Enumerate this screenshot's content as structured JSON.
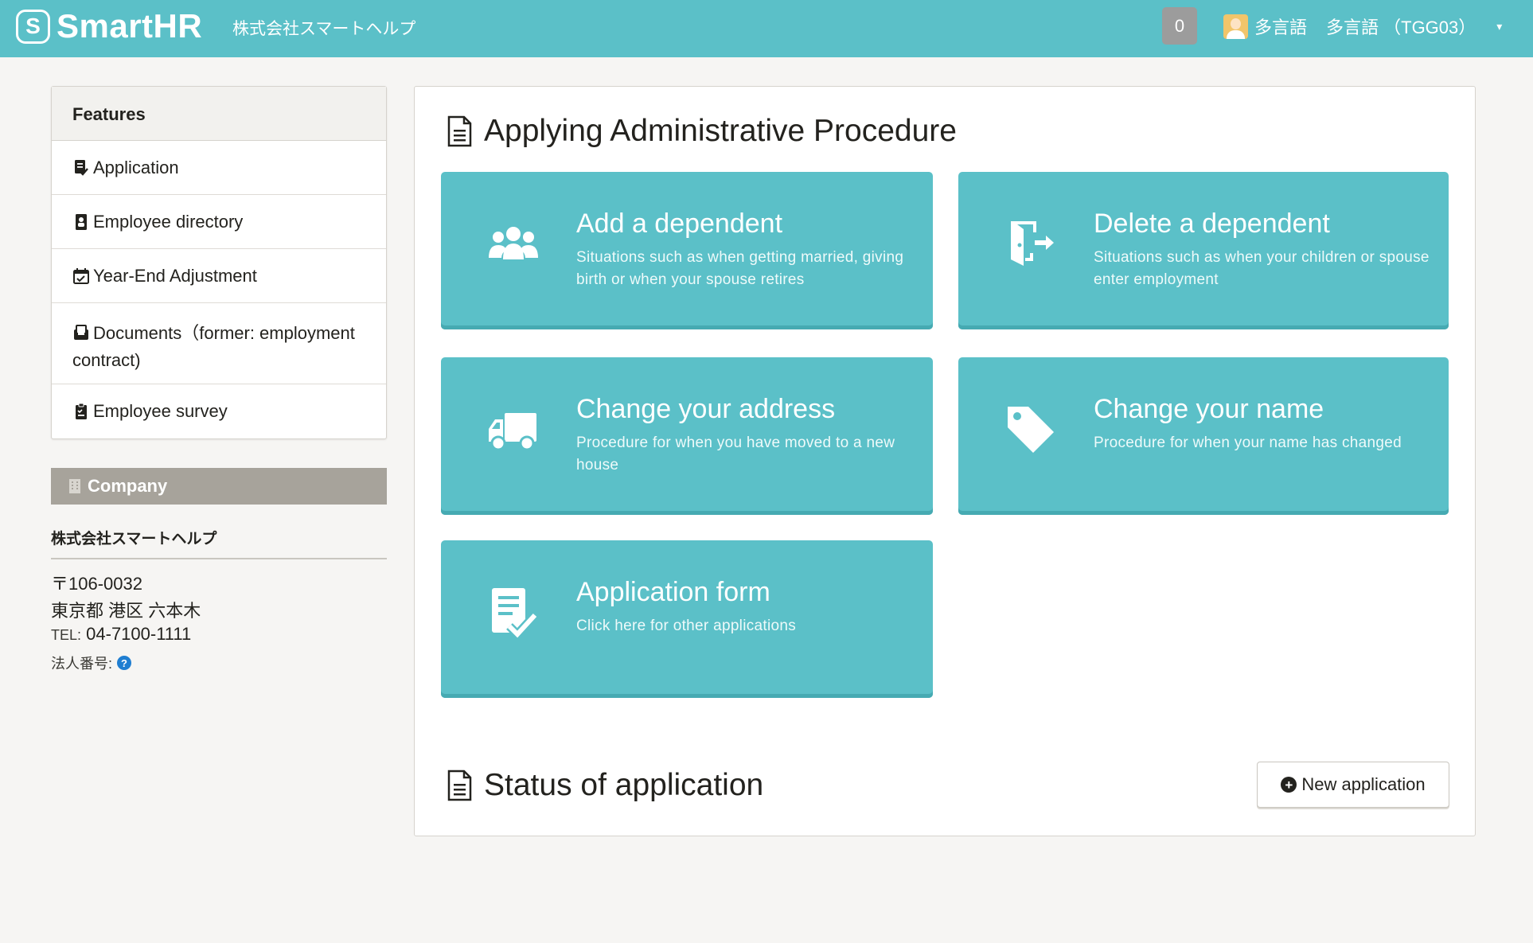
{
  "header": {
    "logo_mark": "S",
    "logo_text": "SmartHR",
    "company": "株式会社スマートヘルプ",
    "notification_count": "0",
    "user_name": "多言語",
    "user_account": "多言語 （TGG03）",
    "caret": "▾"
  },
  "sidebar": {
    "features_title": "Features",
    "items": [
      {
        "label": "Application",
        "icon": "application-icon"
      },
      {
        "label": "Employee directory",
        "icon": "id-card-icon"
      },
      {
        "label": "Year-End Adjustment",
        "icon": "calendar-check-icon"
      },
      {
        "label": "Documents（former: employment contract)",
        "icon": "inbox-icon"
      },
      {
        "label": "Employee survey",
        "icon": "clipboard-icon"
      }
    ],
    "company_title": "Company",
    "company": {
      "name": "株式会社スマートヘルプ",
      "postal": "〒106-0032",
      "address": "東京都 港区 六本木",
      "tel_label": "TEL:",
      "tel": "04-7100-1111",
      "corp_number_label": "法人番号:"
    }
  },
  "main": {
    "procedure_title": "Applying Administrative Procedure",
    "cards": [
      {
        "title": "Add a dependent",
        "desc": "Situations such as when getting married, giving birth or when your spouse retires",
        "icon": "users-icon"
      },
      {
        "title": "Delete a dependent",
        "desc": "Situations such as when your children or spouse enter employment",
        "icon": "exit-door-icon"
      },
      {
        "title": "Change your address",
        "desc": "Procedure for when you have moved to a new house",
        "icon": "truck-icon"
      },
      {
        "title": "Change your name",
        "desc": "Procedure for when your name has changed",
        "icon": "tag-icon"
      },
      {
        "title": "Application form",
        "desc": "Click here for other applications",
        "icon": "form-check-icon"
      }
    ],
    "status_title": "Status of application",
    "new_application_label": "New application"
  },
  "colors": {
    "brand": "#5bc0c8",
    "company_bar": "#a7a39b",
    "background": "#f6f5f3",
    "help_blue": "#1f7ed1"
  }
}
